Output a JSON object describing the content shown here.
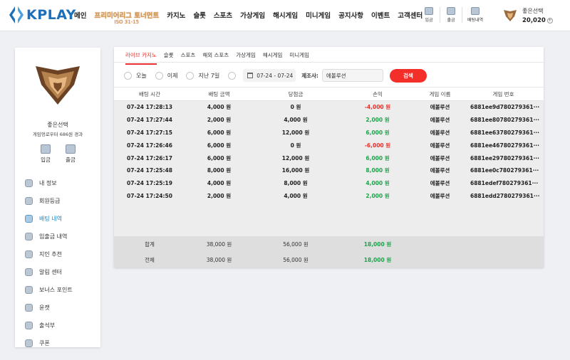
{
  "brand": {
    "logo_text": "KPLAY"
  },
  "nav": {
    "items": [
      "메인",
      "카지노",
      "슬롯",
      "스포츠",
      "가상게임",
      "해시게임",
      "미니게임",
      "공지사항",
      "이벤트",
      "고객센터"
    ],
    "promo": {
      "label": "프리미어리그 토너먼트",
      "sub": "ISO 31-15"
    },
    "deposit": "입금",
    "withdraw": "출금",
    "betting_history": "배팅내역"
  },
  "user": {
    "name": "좋은선택",
    "points": "20,020",
    "plus_icon": "plus-icon"
  },
  "sidebar": {
    "name": "좋은선택",
    "subtitle": "게임엉로우터 686원 경과",
    "deposit_label": "입금",
    "withdraw_label": "출금",
    "menu": [
      {
        "label": "내 정보",
        "icon": "profile-icon"
      },
      {
        "label": "회원등급",
        "icon": "grade-icon"
      },
      {
        "label": "배팅 내역",
        "icon": "betting-icon",
        "active": true
      },
      {
        "label": "입출금 내역",
        "icon": "transaction-icon"
      },
      {
        "label": "지인 추천",
        "icon": "referral-icon"
      },
      {
        "label": "알림 센터",
        "icon": "bell-icon"
      },
      {
        "label": "보너스 포인트",
        "icon": "bonus-icon"
      },
      {
        "label": "윤캣",
        "icon": "cat-icon"
      },
      {
        "label": "출석부",
        "icon": "attendance-icon"
      },
      {
        "label": "쿠폰",
        "icon": "coupon-icon"
      }
    ]
  },
  "tabs": [
    "라이브 카지노",
    "슬롯",
    "스포츠",
    "해외 스포츠",
    "가상게임",
    "해시게임",
    "미니게임"
  ],
  "filters": {
    "today": "오늘",
    "yesterday": "이제",
    "last7": "지난 7일",
    "date_range": "07-24 - 07-24",
    "maker_label": "제조사:",
    "maker_value": "에볼루션",
    "search": "검색"
  },
  "table": {
    "headers": [
      "배팅 시간",
      "배팅 금액",
      "당첨금",
      "손익",
      "게임 이름",
      "게임 번호"
    ],
    "rows": [
      {
        "time": "07-24 17:28:13",
        "bet": "4,000 원",
        "win": "0 원",
        "pl": "-4,000 원",
        "pl_type": "neg",
        "game": "에볼루션",
        "id": "6881ee9d780279361···"
      },
      {
        "time": "07-24 17:27:44",
        "bet": "2,000 원",
        "win": "4,000 원",
        "pl": "2,000 원",
        "pl_type": "pos",
        "game": "에볼루션",
        "id": "6881ee80780279361···"
      },
      {
        "time": "07-24 17:27:15",
        "bet": "6,000 원",
        "win": "12,000 원",
        "pl": "6,000 원",
        "pl_type": "pos",
        "game": "에볼루션",
        "id": "6881ee63780279361···"
      },
      {
        "time": "07-24 17:26:46",
        "bet": "6,000 원",
        "win": "0 원",
        "pl": "-6,000 원",
        "pl_type": "neg",
        "game": "에볼루션",
        "id": "6881ee46780279361···"
      },
      {
        "time": "07-24 17:26:17",
        "bet": "6,000 원",
        "win": "12,000 원",
        "pl": "6,000 원",
        "pl_type": "pos",
        "game": "에볼루션",
        "id": "6881ee29780279361···"
      },
      {
        "time": "07-24 17:25:48",
        "bet": "8,000 원",
        "win": "16,000 원",
        "pl": "8,000 원",
        "pl_type": "pos",
        "game": "에볼루션",
        "id": "6881ee0c780279361···"
      },
      {
        "time": "07-24 17:25:19",
        "bet": "4,000 원",
        "win": "8,000 원",
        "pl": "4,000 원",
        "pl_type": "pos",
        "game": "에볼루션",
        "id": "6881edef780279361···"
      },
      {
        "time": "07-24 17:24:50",
        "bet": "2,000 원",
        "win": "4,000 원",
        "pl": "2,000 원",
        "pl_type": "pos",
        "game": "에볼루션",
        "id": "6881edd2780279361···"
      }
    ],
    "totals": [
      {
        "label": "합계",
        "bet": "38,000 원",
        "win": "56,000 원",
        "pl": "18,000 원"
      },
      {
        "label": "전체",
        "bet": "38,000 원",
        "win": "56,000 원",
        "pl": "18,000 원"
      }
    ]
  },
  "colors": {
    "accent": "#e8322d",
    "positive": "#1aa64a",
    "active_menu": "#1e88c8",
    "brand": "#1e6fb8"
  }
}
